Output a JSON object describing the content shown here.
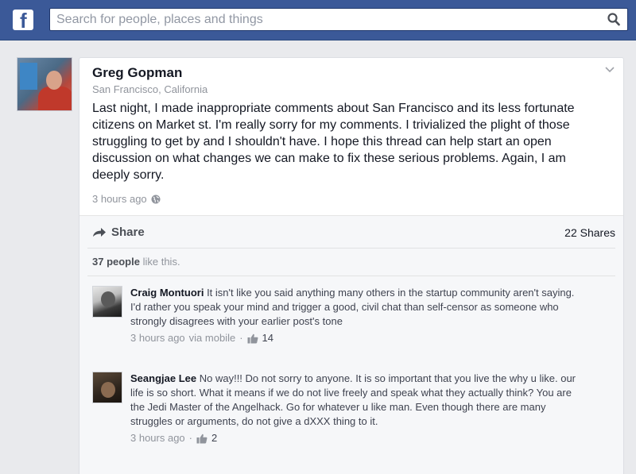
{
  "header": {
    "logo_letter": "f",
    "search_placeholder": "Search for people, places and things"
  },
  "post": {
    "author": "Greg Gopman",
    "location": "San Francisco, California",
    "text": "Last night, I made inappropriate comments about San Francisco and its less fortunate citizens on Market st. I'm really sorry for my comments. I trivialized the plight of those struggling to get by and I shouldn't have. I hope this thread can help start an open discussion on what changes we can make to fix these serious problems. Again, I am deeply sorry.",
    "timestamp": "3 hours ago",
    "share_label": "Share",
    "shares_count": "22 Shares",
    "likes_count": "37 people",
    "likes_suffix": "like this."
  },
  "comments": [
    {
      "author": "Craig Montuori",
      "text": "It isn't like you said anything many others in the startup community aren't saying. I'd rather you speak your mind and trigger a good, civil chat than self-censor as someone who strongly disagrees with your earlier post's tone",
      "timestamp": "3 hours ago",
      "via": "via mobile",
      "like_count": "14"
    },
    {
      "author": "Seangjae Lee",
      "text": "No way!!! Do not sorry to anyone. It is so important that you live the why u like. our life is so short. What it means if we do not live freely and speak what they actually think? You are the Jedi Master of the Angelhack. Go for whatever u like man. Even though there are many struggles or arguments, do not give a dXXX thing to it.",
      "timestamp": "3 hours ago",
      "like_count": "2"
    }
  ],
  "colors": {
    "brand": "#3b5998",
    "background": "#e9eaed",
    "meta_text": "#90949c"
  },
  "icons": [
    "facebook-logo-icon",
    "search-icon",
    "chevron-down-icon",
    "globe-icon",
    "share-arrow-icon",
    "thumbs-up-icon"
  ]
}
